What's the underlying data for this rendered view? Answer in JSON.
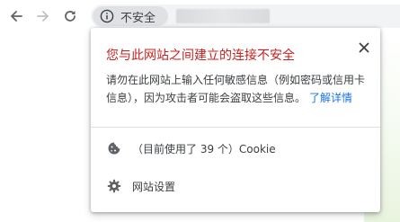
{
  "toolbar": {
    "back_icon": "arrow-left-icon",
    "forward_icon": "arrow-right-icon",
    "reload_icon": "reload-icon",
    "security_chip": {
      "icon": "info-icon",
      "label": "不安全"
    }
  },
  "popup": {
    "title": "您与此网站之间建立的连接不安全",
    "title_color": "#c5221f",
    "close_icon": "close-icon",
    "description_line1": "请勿在此网站上输入任何敏感信息（例如密码或信用卡",
    "description_line2": "信息），因为攻击者可能会盗取这些信息。",
    "learn_more_label": "了解详情",
    "link_color": "#1a73e8",
    "items": [
      {
        "icon": "cookie-icon",
        "label": "（目前使用了 39 个）Cookie"
      },
      {
        "icon": "gear-icon",
        "label": "网站设置"
      }
    ]
  }
}
